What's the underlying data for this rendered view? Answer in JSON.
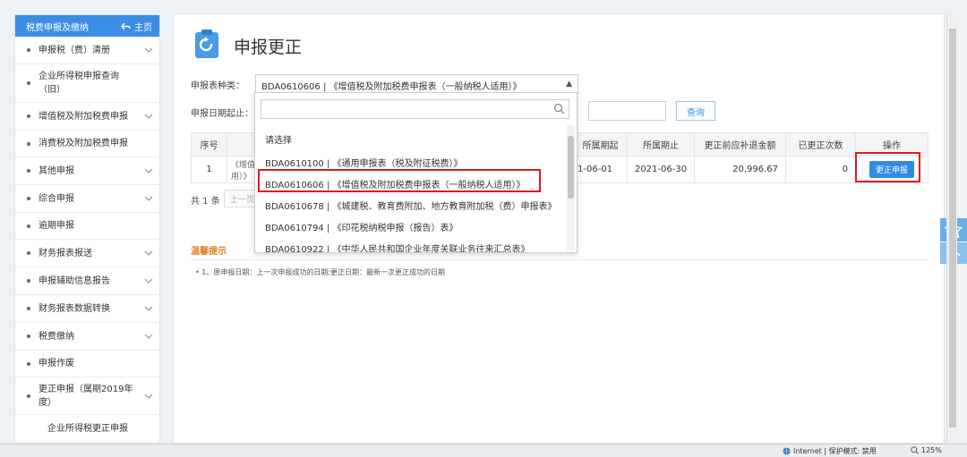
{
  "sidebar": {
    "title": "税费申报及缴纳",
    "home_label": "主页",
    "items": [
      {
        "label": "申报税（费）清册",
        "chevron": true
      },
      {
        "label": "企业所得税申报查询（旧）",
        "chevron": false
      },
      {
        "label": "增值税及附加税费申报",
        "chevron": true
      },
      {
        "label": "消费税及附加税费申报",
        "chevron": false
      },
      {
        "label": "其他申报",
        "chevron": true
      },
      {
        "label": "综合申报",
        "chevron": true
      },
      {
        "label": "逾期申报",
        "chevron": false
      },
      {
        "label": "财务报表报送",
        "chevron": true
      },
      {
        "label": "申报辅助信息报告",
        "chevron": true
      },
      {
        "label": "财务报表数据转换",
        "chevron": true
      },
      {
        "label": "税费缴纳",
        "chevron": true
      },
      {
        "label": "申报作废",
        "chevron": false
      },
      {
        "label": "更正申报（属期2019年度）",
        "chevron": true
      }
    ],
    "sub_item": "企业所得税更正申报"
  },
  "main": {
    "title": "申报更正",
    "form": {
      "type_label": "申报表种类：",
      "type_value": "BDA0610606 | 《增值税及附加税费申报表（一般纳税人适用）》",
      "date_label": "申报日期起止：",
      "query_button": "查询"
    },
    "table": {
      "headers": [
        "序号",
        "",
        "",
        "所属期起",
        "所属期止",
        "更正前应补退金额",
        "已更正次数",
        "操作"
      ],
      "rows": [
        {
          "index": "1",
          "name_fragment": "《增值\n用）》",
          "period_start": "1-06-01",
          "period_end": "2021-06-30",
          "amount": "20,996.67",
          "count": "0",
          "action": "更正申报"
        }
      ]
    },
    "pagination": {
      "total": "共 1 条",
      "prev": "上一页"
    },
    "tips": {
      "title": "温馨提示",
      "text": "• 1、原申报日期：上一次申报成功的日期;更正日期：最新一次更正成功的日期"
    }
  },
  "dropdown": {
    "search_placeholder": "",
    "options": [
      "请选择",
      "BDA0610100 | 《通用申报表（税及附征税费）》",
      "BDA0610606 | 《增值税及附加税费申报表（一般纳税人适用）》",
      "BDA0610678 | 《城建税、教育费附加、地方教育附加税（费）申报表》",
      "BDA0610794 | 《印花税纳税申报（报告）表》",
      "BDA0610922 | 《中华人民共和国企业年度关联业务往来汇总表》"
    ]
  },
  "statusbar": {
    "zone": "Internet | 保护模式: 禁用",
    "zoom": "125%"
  },
  "colors": {
    "accent": "#3a8ee6",
    "highlight": "#e0181d",
    "tips": "#e67e22"
  }
}
